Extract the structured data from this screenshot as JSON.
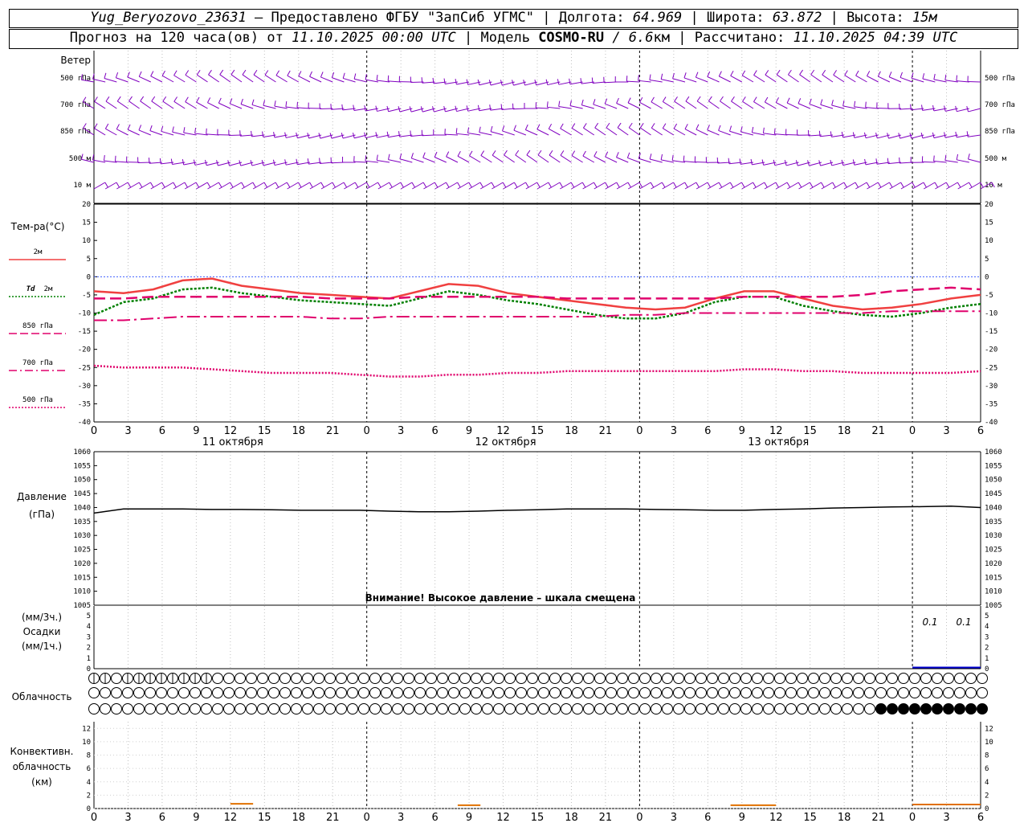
{
  "header": {
    "station": "Yug_Beryozovo_23631",
    "provider": "– Предоставлено ФГБУ \"ЗапСиб УГМС\"",
    "lon_label": "| Долгота:",
    "lon": "64.969",
    "lat_label": "| Широта:",
    "lat": "63.872",
    "alt_label": "| Высота:",
    "alt": "15м",
    "forecast_label": "Прогноз на 120 часа(ов) от",
    "forecast_start": "11.10.2025 00:00 UTC",
    "model_label": "| Модель",
    "model": "COSMO-RU",
    "model_res": "/ 6.6",
    "model_unit": "км",
    "calc_label": "| Рассчитано:",
    "calc_time": "11.10.2025 04:39 UTC"
  },
  "labels": {
    "wind": "Ветер",
    "wind_levels": [
      "500 гПа",
      "700 гПа",
      "850 гПа",
      "500 м",
      "10 м"
    ],
    "temp": "Тем-ра(°С)",
    "t2m": "2м",
    "td": "Td",
    "td2m": "2м",
    "t850": "850 гПа",
    "t700": "700 гПа",
    "t500": "500 гПа",
    "pressure": "Давление",
    "pressure_unit": "(гПа)",
    "pressure_warning": "Внимание! Высокое давление – шкала смещена",
    "precip_3h": "(мм/3ч.)",
    "precip": "Осадки",
    "precip_1h": "(мм/1ч.)",
    "precip_val1": "0.1",
    "precip_val2": "0.1",
    "cloud": "Облачность",
    "conv1": "Конвективн.",
    "conv2": "облачность",
    "conv3": "(км)"
  },
  "colors": {
    "wind": "#8000c0",
    "t2m": "#f04040",
    "td": "#008000",
    "t850": "#e0006c",
    "t700": "#e0006c",
    "t500": "#e0006c",
    "pressure": "#000000",
    "precip": "#0000d0",
    "conv": "#e07000",
    "grid": "#808080"
  },
  "chart_data": [
    {
      "type": "line",
      "title": "Тем-ра(°С)",
      "x_hours": [
        0,
        3,
        6,
        9,
        12,
        15,
        18,
        21,
        24,
        27,
        30,
        33,
        36,
        39,
        42,
        45,
        48,
        51,
        54,
        57,
        60,
        63,
        66,
        69,
        72,
        75,
        78
      ],
      "x_tick_labels": [
        "0",
        "3",
        "6",
        "9",
        "12",
        "15",
        "18",
        "21",
        "0",
        "3",
        "6",
        "9",
        "12",
        "15",
        "18",
        "21",
        "0",
        "3",
        "6",
        "9",
        "12",
        "15",
        "18",
        "21",
        "0",
        "3",
        "6"
      ],
      "day_labels": [
        "11 октября",
        "12 октября",
        "13 октября"
      ],
      "ylim": [
        -40,
        20
      ],
      "y_ticks": [
        20,
        15,
        10,
        5,
        0,
        -5,
        -10,
        -15,
        -20,
        -25,
        -30,
        -35,
        -40
      ],
      "series": [
        {
          "name": "2м",
          "values": [
            -4,
            -4.5,
            -3.5,
            -1,
            -0.5,
            -2.5,
            -3.5,
            -4.5,
            -5,
            -5.5,
            -6,
            -4,
            -2,
            -2.5,
            -4.5,
            -5.5,
            -6.5,
            -7.5,
            -8.5,
            -9,
            -8.5,
            -6,
            -4,
            -4,
            -6,
            -8,
            -9,
            -8.5,
            -7.5,
            -6,
            -5
          ]
        },
        {
          "name": "Td 2м",
          "values": [
            -10.5,
            -7,
            -6,
            -3.5,
            -3,
            -4.5,
            -5.5,
            -6.5,
            -7,
            -7.5,
            -8,
            -6,
            -4,
            -5,
            -6.5,
            -7.5,
            -9,
            -10.5,
            -11.5,
            -11.5,
            -10,
            -7,
            -5.5,
            -5.5,
            -8,
            -9.5,
            -10.5,
            -11,
            -10,
            -8.5,
            -7.5
          ]
        },
        {
          "name": "850 гПа",
          "values": [
            -6,
            -6,
            -5.5,
            -5.5,
            -5.5,
            -5.5,
            -5.5,
            -5.5,
            -6,
            -6,
            -6,
            -5.5,
            -5.5,
            -5.5,
            -5.5,
            -5.5,
            -6,
            -6,
            -6,
            -6,
            -6,
            -6,
            -5.5,
            -5.5,
            -5.5,
            -5.5,
            -5,
            -4,
            -3.5,
            -3,
            -3.5
          ]
        },
        {
          "name": "700 гПа",
          "values": [
            -12,
            -12,
            -11.5,
            -11,
            -11,
            -11,
            -11,
            -11,
            -11.5,
            -11.5,
            -11,
            -11,
            -11,
            -11,
            -11,
            -11,
            -11,
            -11,
            -10.5,
            -10.5,
            -10,
            -10,
            -10,
            -10,
            -10,
            -10,
            -10,
            -9.5,
            -9.5,
            -9.5,
            -9.5
          ]
        },
        {
          "name": "500 гПа",
          "values": [
            -24.5,
            -25,
            -25,
            -25,
            -25.5,
            -26,
            -26.5,
            -26.5,
            -26.5,
            -27,
            -27.5,
            -27.5,
            -27,
            -27,
            -26.5,
            -26.5,
            -26,
            -26,
            -26,
            -26,
            -26,
            -26,
            -25.5,
            -25.5,
            -26,
            -26,
            -26.5,
            -26.5,
            -26.5,
            -26.5,
            -26
          ]
        }
      ],
      "series_x_step_hours": 4
    },
    {
      "type": "line",
      "title": "Давление",
      "ylabel": "(гПа)",
      "ylim": [
        1005,
        1060
      ],
      "y_ticks": [
        1060,
        1055,
        1050,
        1045,
        1040,
        1035,
        1030,
        1025,
        1020,
        1015,
        1010,
        1005
      ],
      "series": [
        {
          "name": "Давление",
          "values": [
            1038,
            1039.5,
            1039.5,
            1039.5,
            1039.3,
            1039.3,
            1039.2,
            1039,
            1039,
            1039,
            1038.7,
            1038.5,
            1038.5,
            1038.7,
            1039,
            1039.2,
            1039.5,
            1039.5,
            1039.5,
            1039.3,
            1039.2,
            1039,
            1039,
            1039.3,
            1039.5,
            1039.8,
            1040,
            1040.2,
            1040.3,
            1040.5,
            1040
          ]
        }
      ],
      "series_x_step_hours": 4
    },
    {
      "type": "bar",
      "title": "Осадки",
      "ylim": [
        0,
        5
      ],
      "y_ticks": [
        5,
        4,
        3,
        2,
        1,
        0
      ],
      "annotations": [
        "0.1",
        "0.1"
      ]
    },
    {
      "type": "area",
      "title": "Конвективн. облачность (км)",
      "ylim": [
        0,
        13
      ],
      "y_ticks": [
        12,
        10,
        8,
        6,
        4,
        2,
        0
      ],
      "segments_hours": [
        [
          12,
          14,
          0.7
        ],
        [
          32,
          34,
          0.5
        ],
        [
          56,
          60,
          0.5
        ],
        [
          72,
          78,
          0.6
        ]
      ]
    }
  ],
  "cloud_rows": {
    "row1_partial": [
      0,
      1,
      3,
      4,
      5,
      6,
      7,
      8,
      9,
      10
    ],
    "row3_full_from": 70,
    "count": 80
  }
}
